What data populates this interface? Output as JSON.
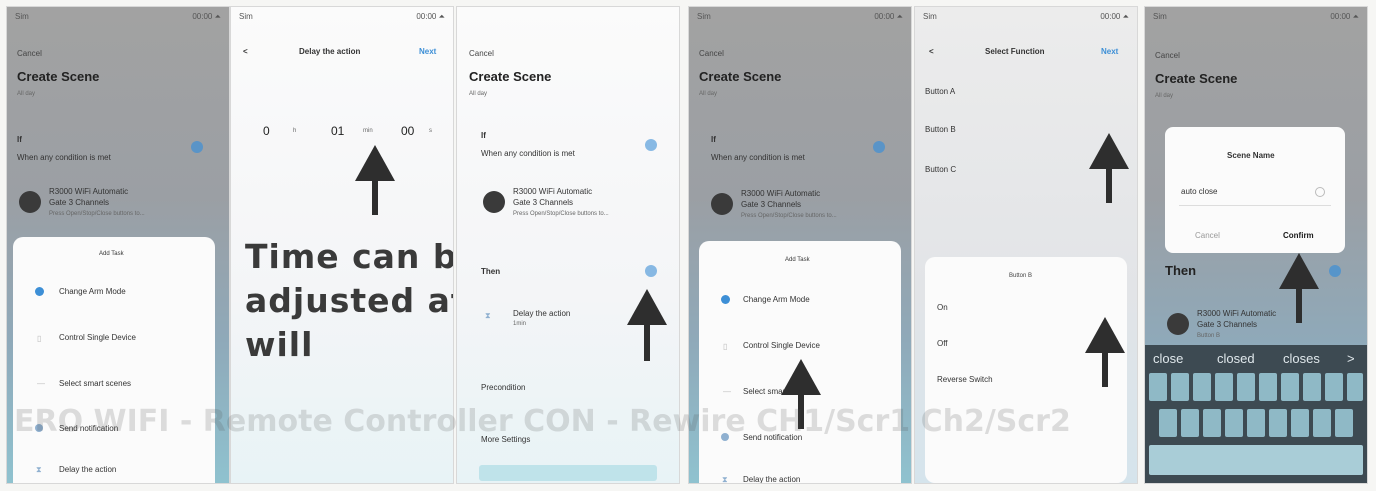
{
  "caption": "ERO WIFI - Remote Controller CON - Rewire CH1/Scr1 Ch2/Scr2",
  "panel1": {
    "status_left": "Sim",
    "status_right": "00:00 ⏶",
    "cancel": "Cancel",
    "title": "Create Scene",
    "subtitle": "All day",
    "if_label": "If",
    "condition": "When any condition is met",
    "device_name": "R3000 WiFi Automatic",
    "device_sub": "Gate 3 Channels",
    "device_detail": "Press Open/Stop/Close buttons to...",
    "sheet_title": "Add Task",
    "items": [
      "Change Arm Mode",
      "Control Single Device",
      "Select smart scenes",
      "Send notification",
      "Delay the action"
    ]
  },
  "panel2": {
    "status_left": "Sim",
    "status_right": "00:00 ⏶",
    "back": "<",
    "title": "Delay the action",
    "next": "Next",
    "hours": "0",
    "hours_unit": "h",
    "minutes": "01",
    "minutes_unit": "min",
    "seconds": "00",
    "seconds_unit": "s",
    "annotation_lines": [
      "Time can be",
      "adjusted at",
      "will"
    ]
  },
  "panel3": {
    "cancel": "Cancel",
    "title": "Create Scene",
    "subtitle": "All day",
    "if_label": "If",
    "condition": "When any condition is met",
    "device_name": "R3000 WiFi Automatic",
    "device_sub": "Gate 3 Channels",
    "device_detail": "Press Open/Stop/Close buttons to...",
    "then_label": "Then",
    "delay_item": "Delay the action",
    "delay_sub": "1min",
    "precondition": "Precondition",
    "more_settings": "More Settings"
  },
  "panel4": {
    "status_left": "Sim",
    "status_right": "00:00 ⏶",
    "cancel": "Cancel",
    "title": "Create Scene",
    "subtitle": "All day",
    "if_label": "If",
    "condition": "When any condition is met",
    "device_name": "R3000 WiFi Automatic",
    "device_sub": "Gate 3 Channels",
    "device_detail": "Press Open/Stop/Close buttons to...",
    "sheet_title": "Add Task",
    "items": [
      "Change Arm Mode",
      "Control Single Device",
      "Select smart scenes",
      "Send notification",
      "Delay the action"
    ]
  },
  "panel5": {
    "status_left": "Sim",
    "status_right": "00:00 ⏶",
    "back": "<",
    "title": "Select Function",
    "next": "Next",
    "buttons": [
      "Button A",
      "Button B",
      "Button C"
    ],
    "sheet_title": "Button B",
    "options": [
      "On",
      "Off",
      "Reverse Switch"
    ]
  },
  "panel6": {
    "status_left": "Sim",
    "status_right": "00:00 ⏶",
    "cancel": "Cancel",
    "title": "Create Scene",
    "subtitle": "All day",
    "dialog_title": "Scene Name",
    "dialog_value": "auto close",
    "dialog_cancel": "Cancel",
    "dialog_confirm": "Confirm",
    "then_label": "Then",
    "device_name": "R3000 WiFi Automatic",
    "device_sub": "Gate 3 Channels",
    "device_detail": "Button B",
    "suggestions": [
      "close",
      "closed",
      "closes",
      ">"
    ]
  },
  "colors": {
    "accent": "#3d8fd6",
    "arrow": "#2e2e2e",
    "confirm": "#1a1a1a"
  }
}
